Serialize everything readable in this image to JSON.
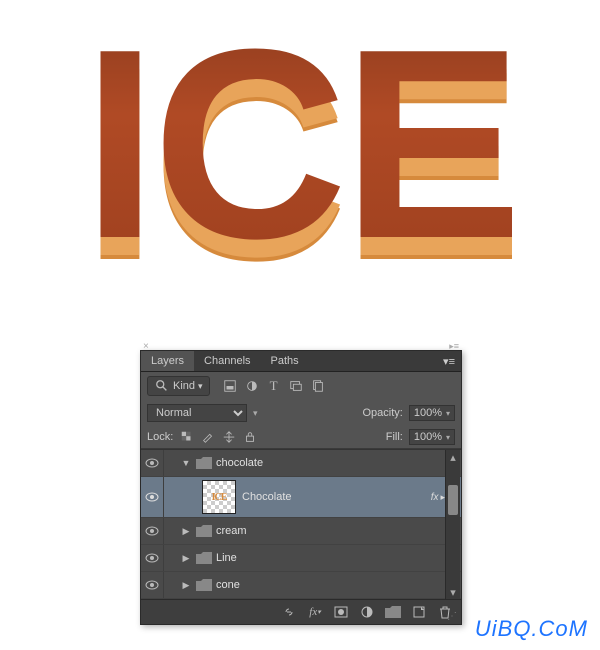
{
  "artwork": {
    "text": "ICE"
  },
  "panel": {
    "tabs": [
      "Layers",
      "Channels",
      "Paths"
    ],
    "filter_kind": "Kind",
    "blend_mode": "Normal",
    "opacity_label": "Opacity:",
    "opacity_value": "100%",
    "lock_label": "Lock:",
    "fill_label": "Fill:",
    "fill_value": "100%",
    "layers": [
      {
        "name": "chocolate",
        "type": "group",
        "expanded": true
      },
      {
        "name": "Chocolate",
        "type": "layer",
        "selected": true,
        "fx": "fx"
      },
      {
        "name": "cream",
        "type": "group",
        "expanded": false
      },
      {
        "name": "Line",
        "type": "group",
        "expanded": false
      },
      {
        "name": "cone",
        "type": "group",
        "expanded": false
      }
    ]
  },
  "watermark": "UiBQ.CoM"
}
